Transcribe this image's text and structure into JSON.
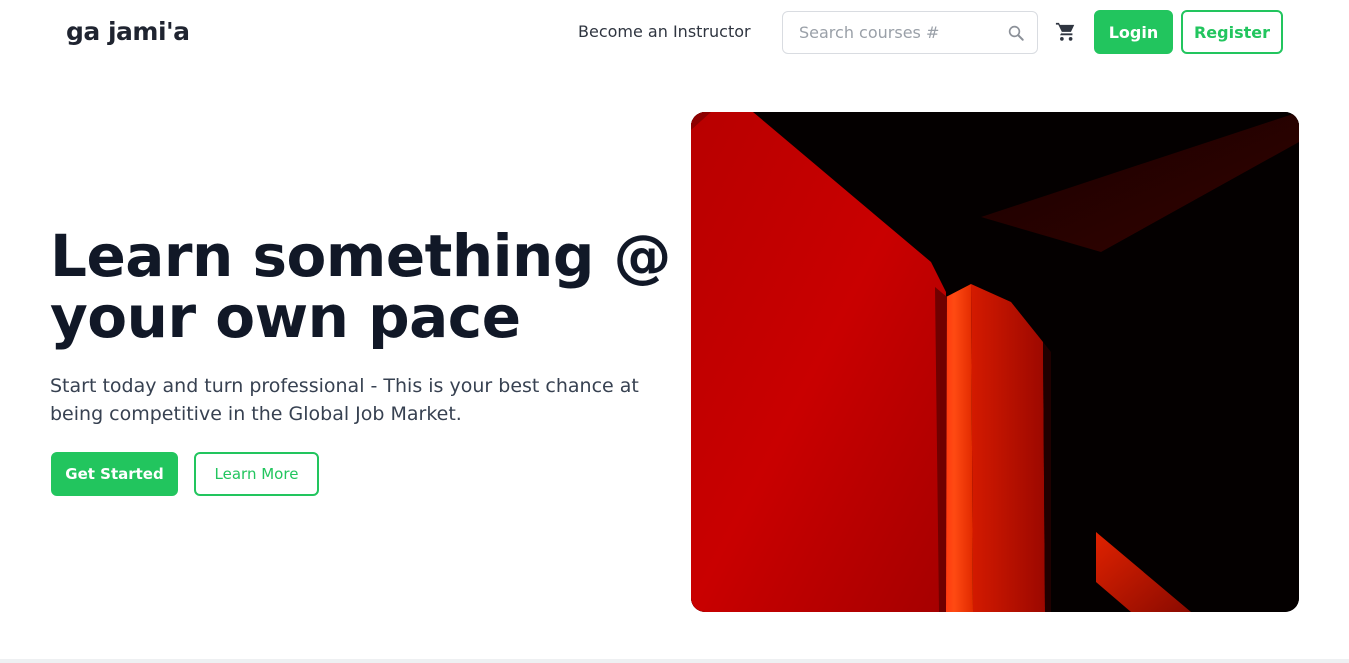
{
  "brand": {
    "logo_text": "ga jami'a"
  },
  "nav": {
    "instructor_link": "Become an Instructor",
    "search_placeholder": "Search courses #",
    "login_label": "Login",
    "register_label": "Register"
  },
  "hero": {
    "title_line1": "Learn something @",
    "title_line2": "your own pace",
    "subtitle": "Start today and turn professional - This is your best chance at being competitive in the Global Job Market.",
    "primary_button": "Get Started",
    "secondary_button": "Learn More"
  },
  "colors": {
    "accent": "#22c55e",
    "heading": "#111827",
    "body_text": "#374151"
  },
  "icons": [
    "search-icon",
    "cart-icon"
  ]
}
